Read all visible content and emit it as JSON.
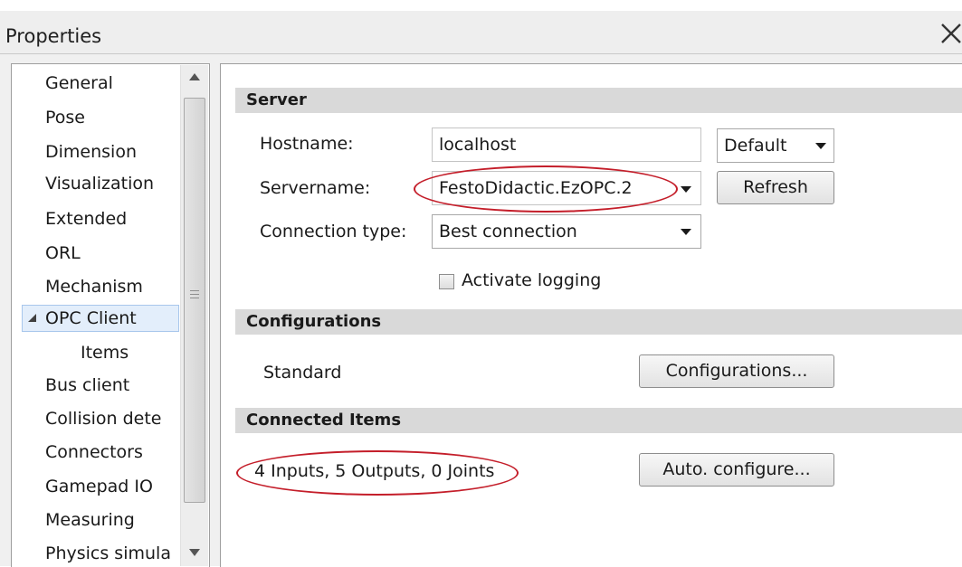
{
  "window": {
    "title": "Properties"
  },
  "nav": {
    "items": [
      {
        "label": "General",
        "level": 0,
        "selected": false
      },
      {
        "label": "Pose",
        "level": 0,
        "selected": false
      },
      {
        "label": "Dimension",
        "level": 0,
        "selected": false
      },
      {
        "label": "Visualization",
        "level": 0,
        "selected": false
      },
      {
        "label": "Extended",
        "level": 0,
        "selected": false
      },
      {
        "label": "ORL",
        "level": 0,
        "selected": false
      },
      {
        "label": "Mechanism",
        "level": 0,
        "selected": false
      },
      {
        "label": "OPC Client",
        "level": 0,
        "selected": true,
        "expanded": true
      },
      {
        "label": "Items",
        "level": 1,
        "selected": false
      },
      {
        "label": "Bus client",
        "level": 0,
        "selected": false
      },
      {
        "label": "Collision dete",
        "level": 0,
        "selected": false
      },
      {
        "label": "Connectors",
        "level": 0,
        "selected": false
      },
      {
        "label": "Gamepad IO",
        "level": 0,
        "selected": false
      },
      {
        "label": "Measuring",
        "level": 0,
        "selected": false
      },
      {
        "label": "Physics simula",
        "level": 0,
        "selected": false
      }
    ]
  },
  "server": {
    "header": "Server",
    "hostname_label": "Hostname:",
    "hostname_value": "localhost",
    "hostname_mode": "Default",
    "servername_label": "Servername:",
    "servername_value": "FestoDidactic.EzOPC.2",
    "refresh_label": "Refresh",
    "connection_type_label": "Connection type:",
    "connection_type_value": "Best connection",
    "logging_label": "Activate logging",
    "logging_checked": false
  },
  "configurations": {
    "header": "Configurations",
    "current": "Standard",
    "button_label": "Configurations..."
  },
  "connected_items": {
    "header": "Connected Items",
    "summary": "4 Inputs, 5 Outputs, 0 Joints",
    "button_label": "Auto. configure..."
  },
  "colors": {
    "highlight_ellipse": "#c41e2a",
    "selection_bg": "#e3eefb",
    "section_header_bg": "#d9d9d9"
  },
  "icons": [
    "close-icon",
    "scroll-up-arrow-icon",
    "scroll-down-arrow-icon",
    "expander-triangle-icon",
    "dropdown-arrow-icon",
    "checkbox-icon"
  ]
}
